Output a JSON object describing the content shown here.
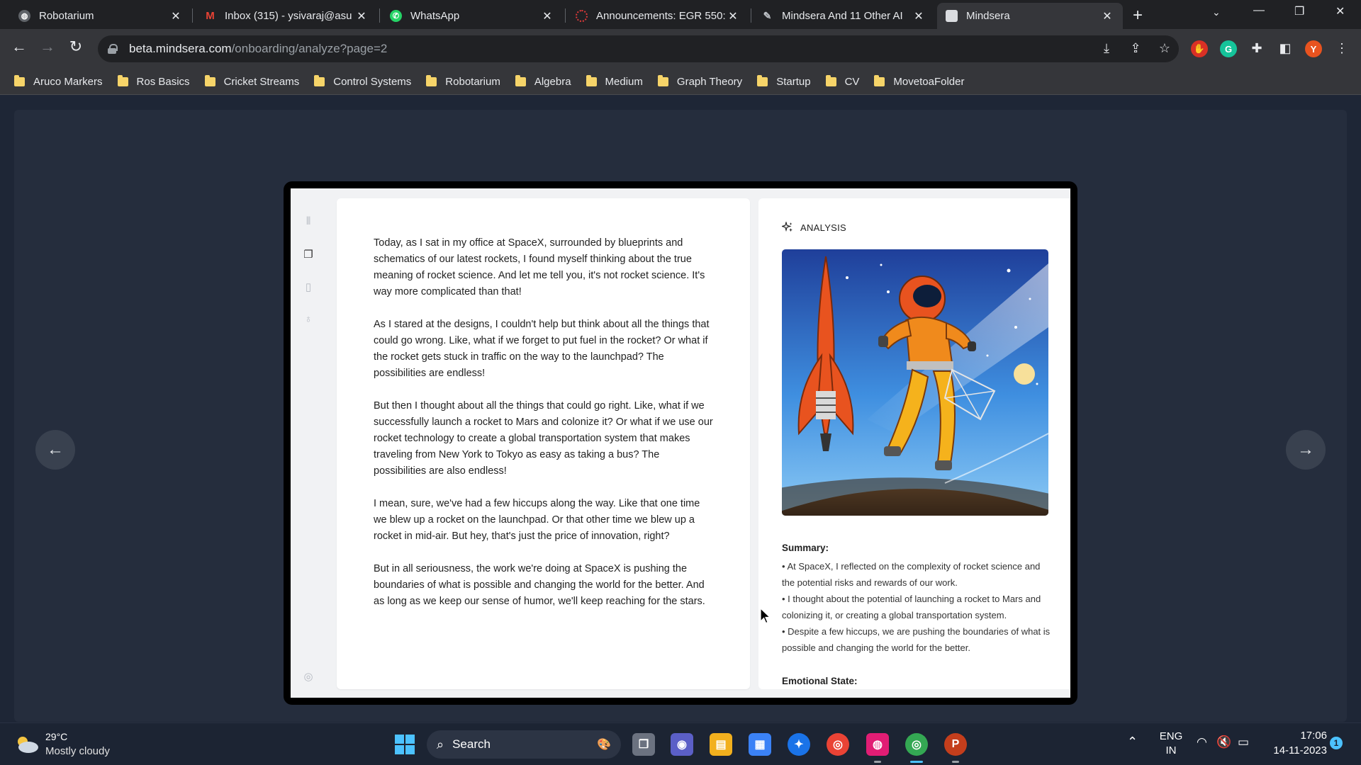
{
  "browser": {
    "tabs": [
      {
        "title": "Robotarium",
        "favicon": "globe-icon",
        "color": "#9aa0a6"
      },
      {
        "title": "Inbox (315) - ysivaraj@asu",
        "favicon": "gmail-icon",
        "color": "#ea4335"
      },
      {
        "title": "WhatsApp",
        "favicon": "whatsapp-icon",
        "color": "#25d366"
      },
      {
        "title": "Announcements: EGR 550:",
        "favicon": "canvas-icon",
        "color": "#e13a3a"
      },
      {
        "title": "Mindsera And 11 Other AI",
        "favicon": "mindsera-icon",
        "color": "#bdc1c6"
      },
      {
        "title": "Mindsera",
        "favicon": "mindsera-icon",
        "color": "#bdc1c6",
        "active": true
      }
    ],
    "url_domain": "beta.mindsera.com",
    "url_path": "/onboarding/analyze?page=2",
    "profile_initial": "Y",
    "bookmarks": [
      "Aruco Markers",
      "Ros Basics",
      "Cricket Streams",
      "Control Systems",
      "Robotarium",
      "Algebra",
      "Medium",
      "Graph Theory",
      "Startup",
      "CV",
      "MovetoaFolder"
    ]
  },
  "journal": {
    "paragraphs": [
      "Today, as I sat in my office at SpaceX, surrounded by blueprints and schematics of our latest rockets, I found myself thinking about the true meaning of rocket science. And let me tell you, it's not rocket science. It's way more complicated than that!",
      "As I stared at the designs, I couldn't help but think about all the things that could go wrong. Like, what if we forget to put fuel in the rocket? Or what if the rocket gets stuck in traffic on the way to the launchpad? The possibilities are endless!",
      "But then I thought about all the things that could go right. Like, what if we successfully launch a rocket to Mars and colonize it? Or what if we use our rocket technology to create a global transportation system that makes traveling from New York to Tokyo as easy as taking a bus? The possibilities are also endless!",
      "I mean, sure, we've had a few hiccups along the way. Like that one time we blew up a rocket on the launchpad. Or that other time we blew up a rocket in mid-air. But hey, that's just the price of innovation, right?",
      "But in all seriousness, the work we're doing at SpaceX is pushing the boundaries of what is possible and changing the world for the better. And as long as we keep our sense of humor, we'll keep reaching for the stars."
    ]
  },
  "analysis": {
    "header": "ANALYSIS",
    "summary_title": "Summary:",
    "summary_items": [
      "• At SpaceX, I reflected on the complexity of rocket science and the potential risks and rewards of our work.",
      "• I thought about the potential of launching a rocket to Mars and colonizing it, or creating a global transportation system.",
      "• Despite a few hiccups, we are pushing the boundaries of what is possible and changing the world for the better."
    ],
    "emotional_title": "Emotional State:"
  },
  "taskbar": {
    "temperature": "29°C",
    "weather": "Mostly cloudy",
    "search_label": "Search",
    "lang_top": "ENG",
    "lang_bottom": "IN",
    "time": "17:06",
    "date": "14-11-2023",
    "notification_count": "1"
  },
  "colors": {
    "accent_blue": "#4a9fe0",
    "rocket_orange": "#e8531f"
  }
}
